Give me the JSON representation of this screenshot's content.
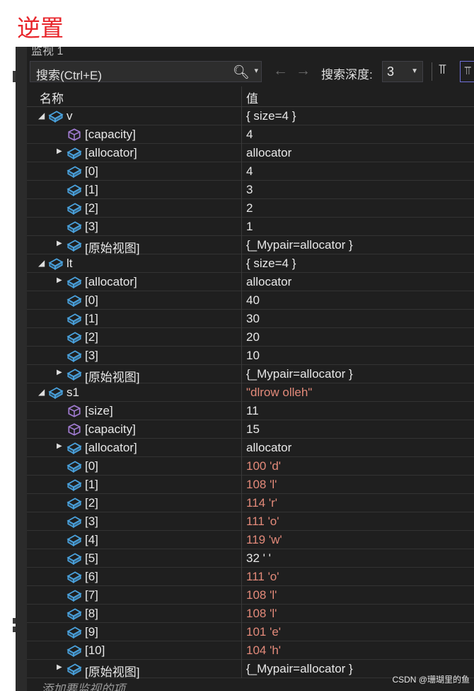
{
  "heading": "逆置",
  "window": {
    "title": "监视 1"
  },
  "toolbar": {
    "search_placeholder": "搜索(Ctrl+E)",
    "depth_label": "搜索深度:",
    "depth_value": "3"
  },
  "columns": {
    "name": "名称",
    "value": "值"
  },
  "rows": [
    {
      "level": 0,
      "expander": "expanded",
      "icon": "object",
      "name": "v",
      "value": "{ size=4 }",
      "color": "normal"
    },
    {
      "level": 1,
      "expander": "none",
      "icon": "property",
      "name": "[capacity]",
      "value": "4",
      "color": "normal"
    },
    {
      "level": 1,
      "expander": "collapsed",
      "icon": "object",
      "name": "[allocator]",
      "value": "allocator",
      "color": "normal"
    },
    {
      "level": 1,
      "expander": "none",
      "icon": "object",
      "name": "[0]",
      "value": "4",
      "color": "normal"
    },
    {
      "level": 1,
      "expander": "none",
      "icon": "object",
      "name": "[1]",
      "value": "3",
      "color": "normal"
    },
    {
      "level": 1,
      "expander": "none",
      "icon": "object",
      "name": "[2]",
      "value": "2",
      "color": "normal"
    },
    {
      "level": 1,
      "expander": "none",
      "icon": "object",
      "name": "[3]",
      "value": "1",
      "color": "normal"
    },
    {
      "level": 1,
      "expander": "collapsed",
      "icon": "object",
      "name": "[原始视图]",
      "value": "{_Mypair=allocator }",
      "color": "normal"
    },
    {
      "level": 0,
      "expander": "expanded",
      "icon": "object",
      "name": "lt",
      "value": "{ size=4 }",
      "color": "normal"
    },
    {
      "level": 1,
      "expander": "collapsed",
      "icon": "object",
      "name": "[allocator]",
      "value": "allocator",
      "color": "normal"
    },
    {
      "level": 1,
      "expander": "none",
      "icon": "object",
      "name": "[0]",
      "value": "40",
      "color": "normal"
    },
    {
      "level": 1,
      "expander": "none",
      "icon": "object",
      "name": "[1]",
      "value": "30",
      "color": "normal"
    },
    {
      "level": 1,
      "expander": "none",
      "icon": "object",
      "name": "[2]",
      "value": "20",
      "color": "normal"
    },
    {
      "level": 1,
      "expander": "none",
      "icon": "object",
      "name": "[3]",
      "value": "10",
      "color": "normal"
    },
    {
      "level": 1,
      "expander": "collapsed",
      "icon": "object",
      "name": "[原始视图]",
      "value": "{_Mypair=allocator }",
      "color": "normal"
    },
    {
      "level": 0,
      "expander": "expanded",
      "icon": "object",
      "name": "s1",
      "value": "\"dlrow olleh\"",
      "color": "string"
    },
    {
      "level": 1,
      "expander": "none",
      "icon": "property",
      "name": "[size]",
      "value": "11",
      "color": "normal"
    },
    {
      "level": 1,
      "expander": "none",
      "icon": "property",
      "name": "[capacity]",
      "value": "15",
      "color": "normal"
    },
    {
      "level": 1,
      "expander": "collapsed",
      "icon": "object",
      "name": "[allocator]",
      "value": "allocator",
      "color": "normal"
    },
    {
      "level": 1,
      "expander": "none",
      "icon": "object",
      "name": "[0]",
      "value": "100 'd'",
      "color": "string"
    },
    {
      "level": 1,
      "expander": "none",
      "icon": "object",
      "name": "[1]",
      "value": "108 'l'",
      "color": "string"
    },
    {
      "level": 1,
      "expander": "none",
      "icon": "object",
      "name": "[2]",
      "value": "114 'r'",
      "color": "string"
    },
    {
      "level": 1,
      "expander": "none",
      "icon": "object",
      "name": "[3]",
      "value": "111 'o'",
      "color": "string"
    },
    {
      "level": 1,
      "expander": "none",
      "icon": "object",
      "name": "[4]",
      "value": "119 'w'",
      "color": "string"
    },
    {
      "level": 1,
      "expander": "none",
      "icon": "object",
      "name": "[5]",
      "value": "32 ' '",
      "color": "normal"
    },
    {
      "level": 1,
      "expander": "none",
      "icon": "object",
      "name": "[6]",
      "value": "111 'o'",
      "color": "string"
    },
    {
      "level": 1,
      "expander": "none",
      "icon": "object",
      "name": "[7]",
      "value": "108 'l'",
      "color": "string"
    },
    {
      "level": 1,
      "expander": "none",
      "icon": "object",
      "name": "[8]",
      "value": "108 'l'",
      "color": "string"
    },
    {
      "level": 1,
      "expander": "none",
      "icon": "object",
      "name": "[9]",
      "value": "101 'e'",
      "color": "string"
    },
    {
      "level": 1,
      "expander": "none",
      "icon": "object",
      "name": "[10]",
      "value": "104 'h'",
      "color": "string"
    },
    {
      "level": 1,
      "expander": "collapsed",
      "icon": "object",
      "name": "[原始视图]",
      "value": "{_Mypair=allocator }",
      "color": "normal"
    }
  ],
  "add_item_hint": "添加要监视的项",
  "watermark": "CSDN @珊瑚里的鱼",
  "colors": {
    "heading": "#e8262c",
    "panel_bg": "#1f1f1f",
    "string_value": "#e38a7a",
    "object_icon": "#4aa3df",
    "property_icon": "#a07bd0"
  }
}
